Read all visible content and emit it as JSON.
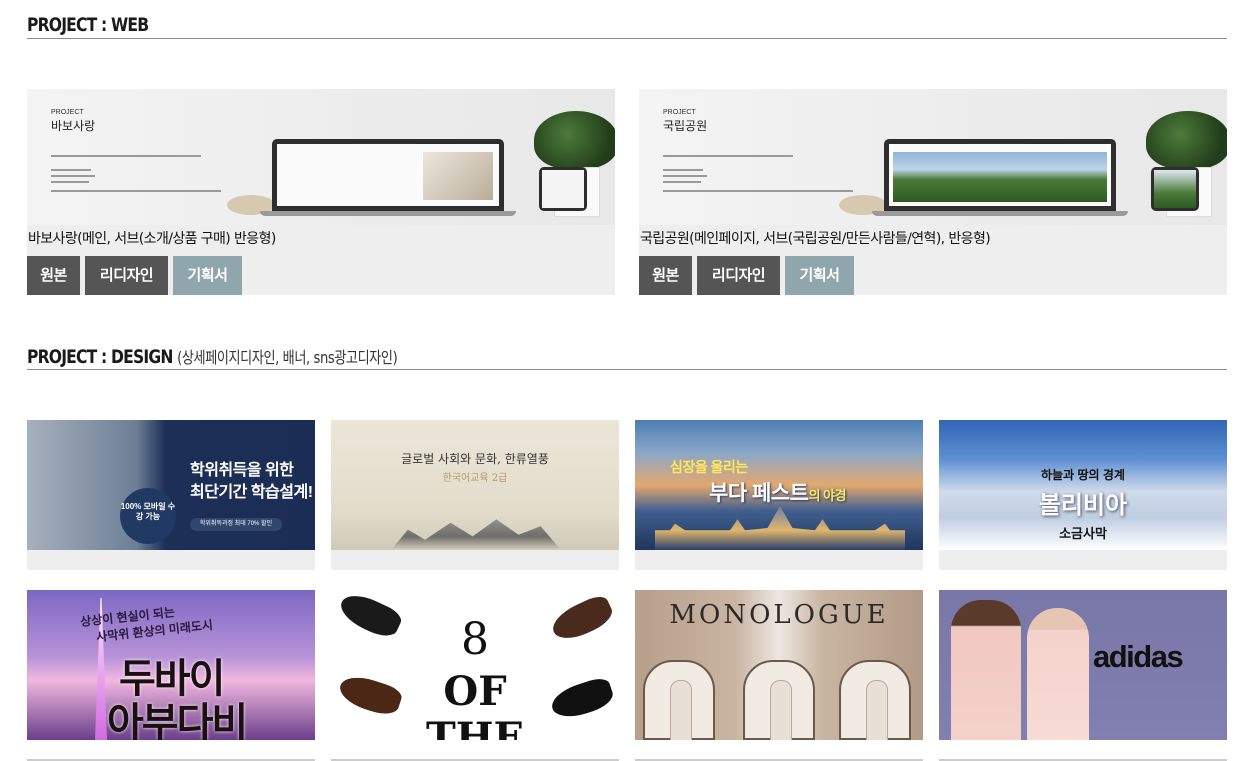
{
  "sections": {
    "web": {
      "title": "PROJECT : WEB"
    },
    "design": {
      "title": "PROJECT : DESIGN",
      "subtitle": "(상세페이지디자인, 배너, sns광고디자인)"
    }
  },
  "web_projects": [
    {
      "mock_brand": "PROJECT",
      "mock_title": "바보사랑",
      "caption": "바보사랑(메인, 서브(소개/상품 구매) 반응형)",
      "buttons": [
        "원본",
        "리디자인",
        "기획서"
      ]
    },
    {
      "mock_brand": "PROJECT",
      "mock_title": "국립공원",
      "caption": "국립공원(메인페이지, 서브(국립공원/만든사람들/연혁), 반응형)",
      "buttons": [
        "원본",
        "리디자인",
        "기획서"
      ]
    }
  ],
  "design_banners": {
    "b1": {
      "title1": "학위취득을 위한",
      "title2": "최단기간 학습설계!",
      "badge": "100% 모바일 수강 가능",
      "pill": "학위취득과정 최대 70% 할인"
    },
    "b2": {
      "title": "글로벌 사회와 문화, 한류열풍",
      "subtitle": "한국어교육 2급"
    },
    "b3": {
      "line1": "심장을 울리는",
      "line2": "부다 페스트",
      "line2_suffix": "의 야경"
    },
    "b4": {
      "line1": "하늘과 땅의 경계",
      "line2": "볼리비아",
      "line3": "소금사막"
    },
    "b5": {
      "line1": "상상이 현실이 되는",
      "line2": "사막위 환상의 미래도시",
      "line3": "두바이",
      "line4": "아부다비"
    },
    "b6": {
      "number": "8",
      "word1": "OF",
      "word2": "THE"
    },
    "b7": {
      "title": "MONOLOGUE"
    },
    "b8": {
      "logo": "adidas"
    }
  }
}
